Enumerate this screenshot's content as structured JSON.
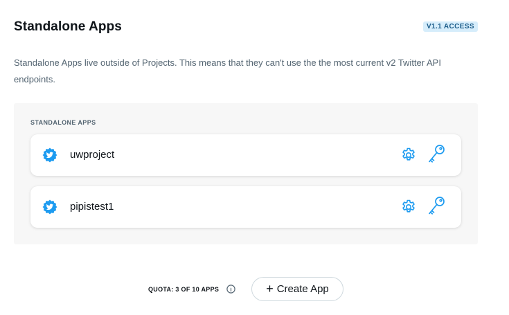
{
  "header": {
    "title": "Standalone Apps",
    "access_badge": "V1.1 ACCESS"
  },
  "description": "Standalone Apps live outside of Projects. This means that they can't use the the most current v2 Twitter API endpoints.",
  "panel": {
    "heading": "STANDALONE APPS",
    "apps": [
      {
        "name": "uwproject",
        "avatar_icon": "twitter-badge-icon",
        "actions": [
          "gear-icon",
          "key-icon"
        ]
      },
      {
        "name": "pipistest1",
        "avatar_icon": "twitter-badge-icon",
        "actions": [
          "gear-icon",
          "key-icon"
        ]
      }
    ]
  },
  "footer": {
    "quota": "QUOTA: 3 OF 10 APPS",
    "create_button": "Create App",
    "create_icon": "+"
  },
  "colors": {
    "accent": "#1d9bf0",
    "badge_bg": "#d6edfb",
    "badge_text": "#1d5d8a",
    "panel_bg": "#f7f7f7",
    "muted_text": "#536471"
  }
}
